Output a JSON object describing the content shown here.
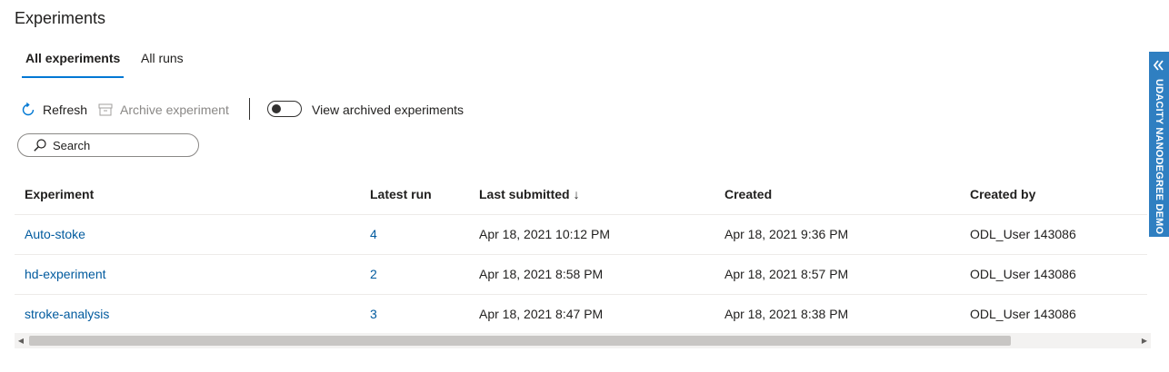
{
  "page": {
    "title": "Experiments"
  },
  "tabs": [
    {
      "label": "All experiments",
      "active": true
    },
    {
      "label": "All runs",
      "active": false
    }
  ],
  "toolbar": {
    "refresh_label": "Refresh",
    "refresh_icon": "refresh-icon",
    "archive_label": "Archive experiment",
    "archive_icon": "archive-icon",
    "toggle_label": "View archived experiments",
    "toggle_on": false
  },
  "search": {
    "placeholder": "Search",
    "value": "",
    "icon": "search-icon"
  },
  "table": {
    "columns": [
      "Experiment",
      "Latest run",
      "Last submitted",
      "Created",
      "Created by"
    ],
    "sort_indicator": "↓",
    "rows": [
      {
        "experiment": "Auto-stoke",
        "latest_run": "4",
        "last_submitted": "Apr 18, 2021 10:12 PM",
        "created": "Apr 18, 2021 9:36 PM",
        "created_by": "ODL_User 143086"
      },
      {
        "experiment": "hd-experiment",
        "latest_run": "2",
        "last_submitted": "Apr 18, 2021 8:58 PM",
        "created": "Apr 18, 2021 8:57 PM",
        "created_by": "ODL_User 143086"
      },
      {
        "experiment": "stroke-analysis",
        "latest_run": "3",
        "last_submitted": "Apr 18, 2021 8:47 PM",
        "created": "Apr 18, 2021 8:38 PM",
        "created_by": "ODL_User 143086"
      }
    ]
  },
  "side_banner": {
    "label": "UDACITY NANODEGREE DEMO",
    "icon": "double-chevron-left-icon"
  },
  "colors": {
    "accent": "#0078d4",
    "link": "#005a9e",
    "banner": "#2f7fc1"
  }
}
